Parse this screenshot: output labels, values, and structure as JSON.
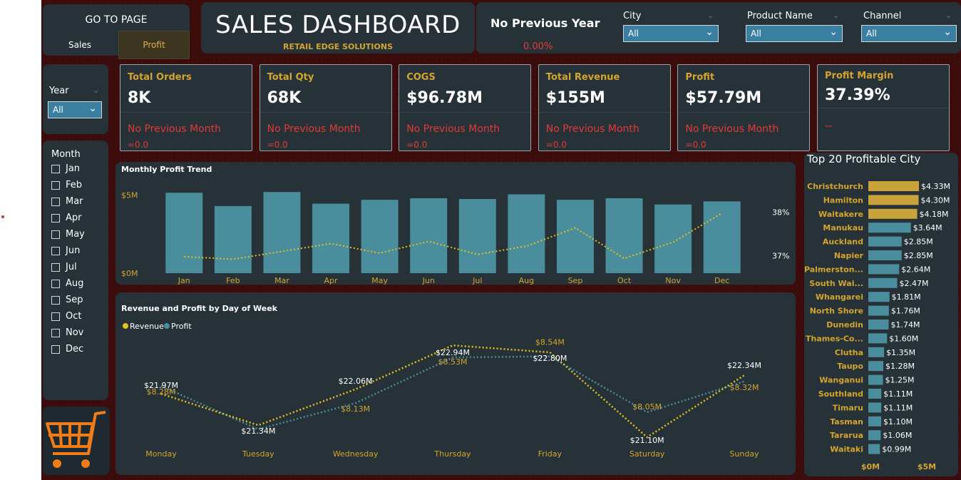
{
  "nav": {
    "title": "GO TO PAGE",
    "sales_label": "Sales",
    "profit_label": "Profit"
  },
  "header": {
    "title": "SALES DASHBOARD",
    "subtitle": "RETAIL EDGE SOLUTIONS"
  },
  "previous_year": {
    "label": "No Previous Year",
    "value": "0.00%"
  },
  "filters": {
    "city": {
      "label": "City",
      "value": "All"
    },
    "product": {
      "label": "Product Name",
      "value": "All"
    },
    "channel": {
      "label": "Channel",
      "value": "All"
    },
    "year": {
      "label": "Year",
      "value": "All"
    }
  },
  "kpis": [
    {
      "title": "Total Orders",
      "value": "8K",
      "compare": "No Previous Month",
      "delta": "=0.0"
    },
    {
      "title": "Total Qty",
      "value": "68K",
      "compare": "No Previous Month",
      "delta": "=0.0"
    },
    {
      "title": "COGS",
      "value": "$96.78M",
      "compare": "No Previous Month",
      "delta": "=0.0"
    },
    {
      "title": "Total Revenue",
      "value": "$155M",
      "compare": "No Previous Month",
      "delta": "=0.0"
    },
    {
      "title": "Profit",
      "value": "$57.79M",
      "compare": "No Previous Month",
      "delta": "=0.0"
    },
    {
      "title": "Profit Margin",
      "value": "37.39%",
      "compare": "--",
      "delta": ""
    }
  ],
  "months": {
    "title": "Month",
    "items": [
      "Jan",
      "Feb",
      "Mar",
      "Apr",
      "May",
      "Jun",
      "Jul",
      "Aug",
      "Sep",
      "Oct",
      "Nov",
      "Dec"
    ]
  },
  "colors": {
    "accent": "#d4a52e",
    "teal": "#4a8d9c",
    "alert": "#e53935",
    "panel": "#263238"
  },
  "icons": {
    "cart": "shopping-cart-icon"
  },
  "chart_data": [
    {
      "type": "bar",
      "title": "Monthly Profit Trend",
      "categories": [
        "Jan",
        "Feb",
        "Mar",
        "Apr",
        "May",
        "Jun",
        "Jul",
        "Aug",
        "Sep",
        "Oct",
        "Nov",
        "Dec"
      ],
      "y_tick_labels": [
        "$0M",
        "$5M"
      ],
      "ylim": [
        0,
        5.3
      ],
      "y2_tick_labels": [
        "37%",
        "38%"
      ],
      "y2lim": [
        36.6,
        38.5
      ],
      "series": [
        {
          "values": [
            5.15,
            4.3,
            5.2,
            4.45,
            4.7,
            4.8,
            4.75,
            5.05,
            4.7,
            4.8,
            4.4,
            4.6
          ]
        },
        {
          "values": [
            36.98,
            36.92,
            37.1,
            37.28,
            37.06,
            37.33,
            37.03,
            37.22,
            37.64,
            36.94,
            37.31,
            37.98
          ]
        }
      ]
    },
    {
      "type": "line",
      "title": "Revenue and Profit by Day of Week",
      "categories": [
        "Monday",
        "Tuesday",
        "Wednesday",
        "Thursday",
        "Friday",
        "Saturday",
        "Sunday"
      ],
      "series": [
        {
          "name": "Revenue",
          "values": [
            21.97,
            21.34,
            22.06,
            22.94,
            22.8,
            21.1,
            22.34
          ],
          "labels": [
            "$21.97M",
            "$21.34M",
            "$22.06M",
            "$22.94M",
            "$22.80M",
            "$21.10M",
            "$22.34M"
          ]
        },
        {
          "name": "Profit",
          "values": [
            8.28,
            7.9,
            8.13,
            8.53,
            8.54,
            8.05,
            8.32
          ],
          "labels": [
            "$8.28M",
            "",
            "$8.13M",
            "$8.53M",
            "$8.54M",
            "$8.05M",
            "$8.32M"
          ]
        }
      ]
    },
    {
      "type": "bar",
      "title": "Top 20 Profitable City",
      "categories": [
        "Christchurch",
        "Hamilton",
        "Waitakere",
        "Manukau",
        "Auckland",
        "Napier",
        "Palmerston...",
        "South Wai...",
        "Whangarei",
        "North Shore",
        "Dunedin",
        "Thames-Co...",
        "Clutha",
        "Taupo",
        "Wanganui",
        "Southland",
        "Timaru",
        "Tasman",
        "Tararua",
        "Waitaki"
      ],
      "values": [
        4.33,
        4.3,
        4.18,
        3.64,
        2.85,
        2.85,
        2.64,
        2.47,
        1.81,
        1.76,
        1.74,
        1.6,
        1.35,
        1.28,
        1.25,
        1.11,
        1.11,
        1.1,
        1.06,
        0.99
      ],
      "labels": [
        "$4.33M",
        "$4.30M",
        "$4.18M",
        "$3.64M",
        "$2.85M",
        "$2.85M",
        "$2.64M",
        "$2.47M",
        "$1.81M",
        "$1.76M",
        "$1.74M",
        "$1.60M",
        "$1.35M",
        "$1.28M",
        "$1.25M",
        "$1.11M",
        "$1.11M",
        "$1.10M",
        "$1.06M",
        "$0.99M"
      ],
      "x_tick_labels": [
        "$0M",
        "$5M"
      ],
      "xlim": [
        0,
        5
      ]
    }
  ]
}
